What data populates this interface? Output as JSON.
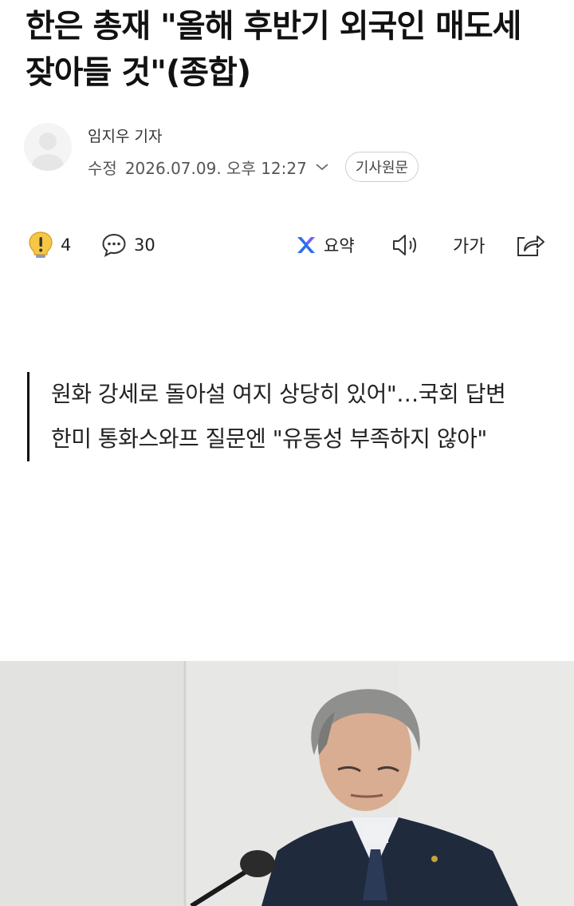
{
  "article": {
    "title": "한은 총재 \"올해 후반기 외국인 매도세 잦아들 것\"(종합)",
    "reporter": "임지우 기자",
    "timestamp_label": "수정",
    "timestamp": "2026.07.09. 오후 12:27",
    "original_button": "기사원문"
  },
  "actions": {
    "reaction_count": "4",
    "comment_count": "30",
    "summary_label": "요약",
    "font_size_label": "가가"
  },
  "subheads": [
    "원화 강세로 돌아설 여지 상당히 있어\"…국회 답변",
    "한미 통화스와프 질문엔 \"유동성 부족하지 않아\""
  ],
  "colors": {
    "summary_accent": "#2a6ff0",
    "summary_accent_2": "#7b5cf0",
    "reaction_yellow": "#f6c744",
    "photo_background": "#e7e7e5"
  },
  "icons": {
    "reaction": "exclamation-bulb-icon",
    "comment": "speech-bubble-icon",
    "summary": "ai-summary-icon",
    "tts": "speaker-icon",
    "font": "font-size-icon",
    "share": "share-icon",
    "chevron": "chevron-down-icon"
  }
}
